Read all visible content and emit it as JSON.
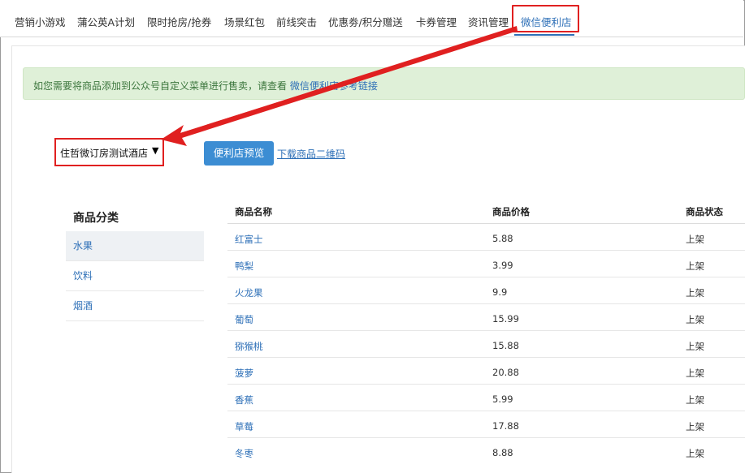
{
  "nav": {
    "tabs": [
      {
        "label": "营销小游戏"
      },
      {
        "label": "蒲公英A计划"
      },
      {
        "label": "限时抢房/抢券"
      },
      {
        "label": "场景红包"
      },
      {
        "label": "前线突击"
      },
      {
        "label": "优惠劵/积分赠送"
      },
      {
        "label": "卡券管理"
      },
      {
        "label": "资讯管理"
      },
      {
        "label": "微信便利店"
      }
    ],
    "active_index": 8
  },
  "notice": {
    "text": "如您需要将商品添加到公众号自定义菜单进行售卖，请查看",
    "link": "微信便利店参考链接"
  },
  "toolbar": {
    "hotel_selected": "住哲微订房测试酒店",
    "preview_button": "便利店预览",
    "download_link": "下载商品二维码"
  },
  "categories": {
    "title": "商品分类",
    "items": [
      "水果",
      "饮料",
      "烟酒"
    ],
    "active_index": 0
  },
  "table": {
    "headers": [
      "商品名称",
      "商品价格",
      "商品状态"
    ],
    "rows": [
      [
        "红富士",
        "5.88",
        "上架"
      ],
      [
        "鸭梨",
        "3.99",
        "上架"
      ],
      [
        "火龙果",
        "9.9",
        "上架"
      ],
      [
        "葡萄",
        "15.99",
        "上架"
      ],
      [
        "猕猴桃",
        "15.88",
        "上架"
      ],
      [
        "菠萝",
        "20.88",
        "上架"
      ],
      [
        "香蕉",
        "5.99",
        "上架"
      ],
      [
        "草莓",
        "17.88",
        "上架"
      ],
      [
        "冬枣",
        "8.88",
        "上架"
      ]
    ]
  },
  "colors": {
    "accent": "#2d6fb7",
    "highlight": "#e02020",
    "notice_bg": "#dff0d8",
    "button": "#3c8dd3"
  },
  "icons": {
    "select_caret": "caret-down-icon",
    "annotation": "red-arrow-icon"
  }
}
